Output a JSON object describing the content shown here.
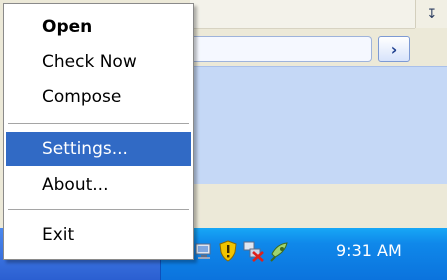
{
  "context_menu": {
    "items": [
      {
        "label": "Open",
        "bold": true
      },
      {
        "label": "Check Now"
      },
      {
        "label": "Compose"
      },
      {
        "label": "Settings...",
        "selected": true
      },
      {
        "label": "About..."
      },
      {
        "label": "Exit"
      }
    ]
  },
  "background_window": {
    "dropdown_icon": "dropdown-arrow-icon",
    "go_icon": "chevron-right-icon"
  },
  "taskbar": {
    "clock": "9:31 AM",
    "tray_icons": [
      "network-icon",
      "security-shield-icon",
      "network-disconnected-icon",
      "satellite-dish-icon"
    ]
  },
  "colors": {
    "selection": "#316AC5",
    "tray": "#0F88EA",
    "taskbar": "#1F56CC",
    "panel": "#C5D8F6"
  }
}
